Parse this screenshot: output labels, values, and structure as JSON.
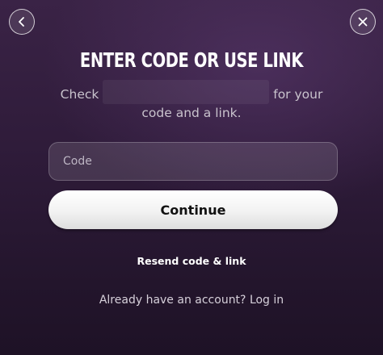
{
  "header": {
    "back_icon": "chevron-left-icon",
    "close_icon": "close-icon"
  },
  "dialog": {
    "title": "ENTER CODE OR USE LINK",
    "subtitle_before": "Check",
    "subtitle_after": "for your",
    "subtitle_line2": "code and a link."
  },
  "form": {
    "code_placeholder": "Code",
    "code_value": "",
    "continue_label": "Continue"
  },
  "links": {
    "resend_label": "Resend code & link",
    "account_prompt": "Already have an account?",
    "login_label": "Log in"
  },
  "colors": {
    "background": "#2e1b39",
    "button_bg": "#ffffff",
    "button_text": "#111111"
  }
}
